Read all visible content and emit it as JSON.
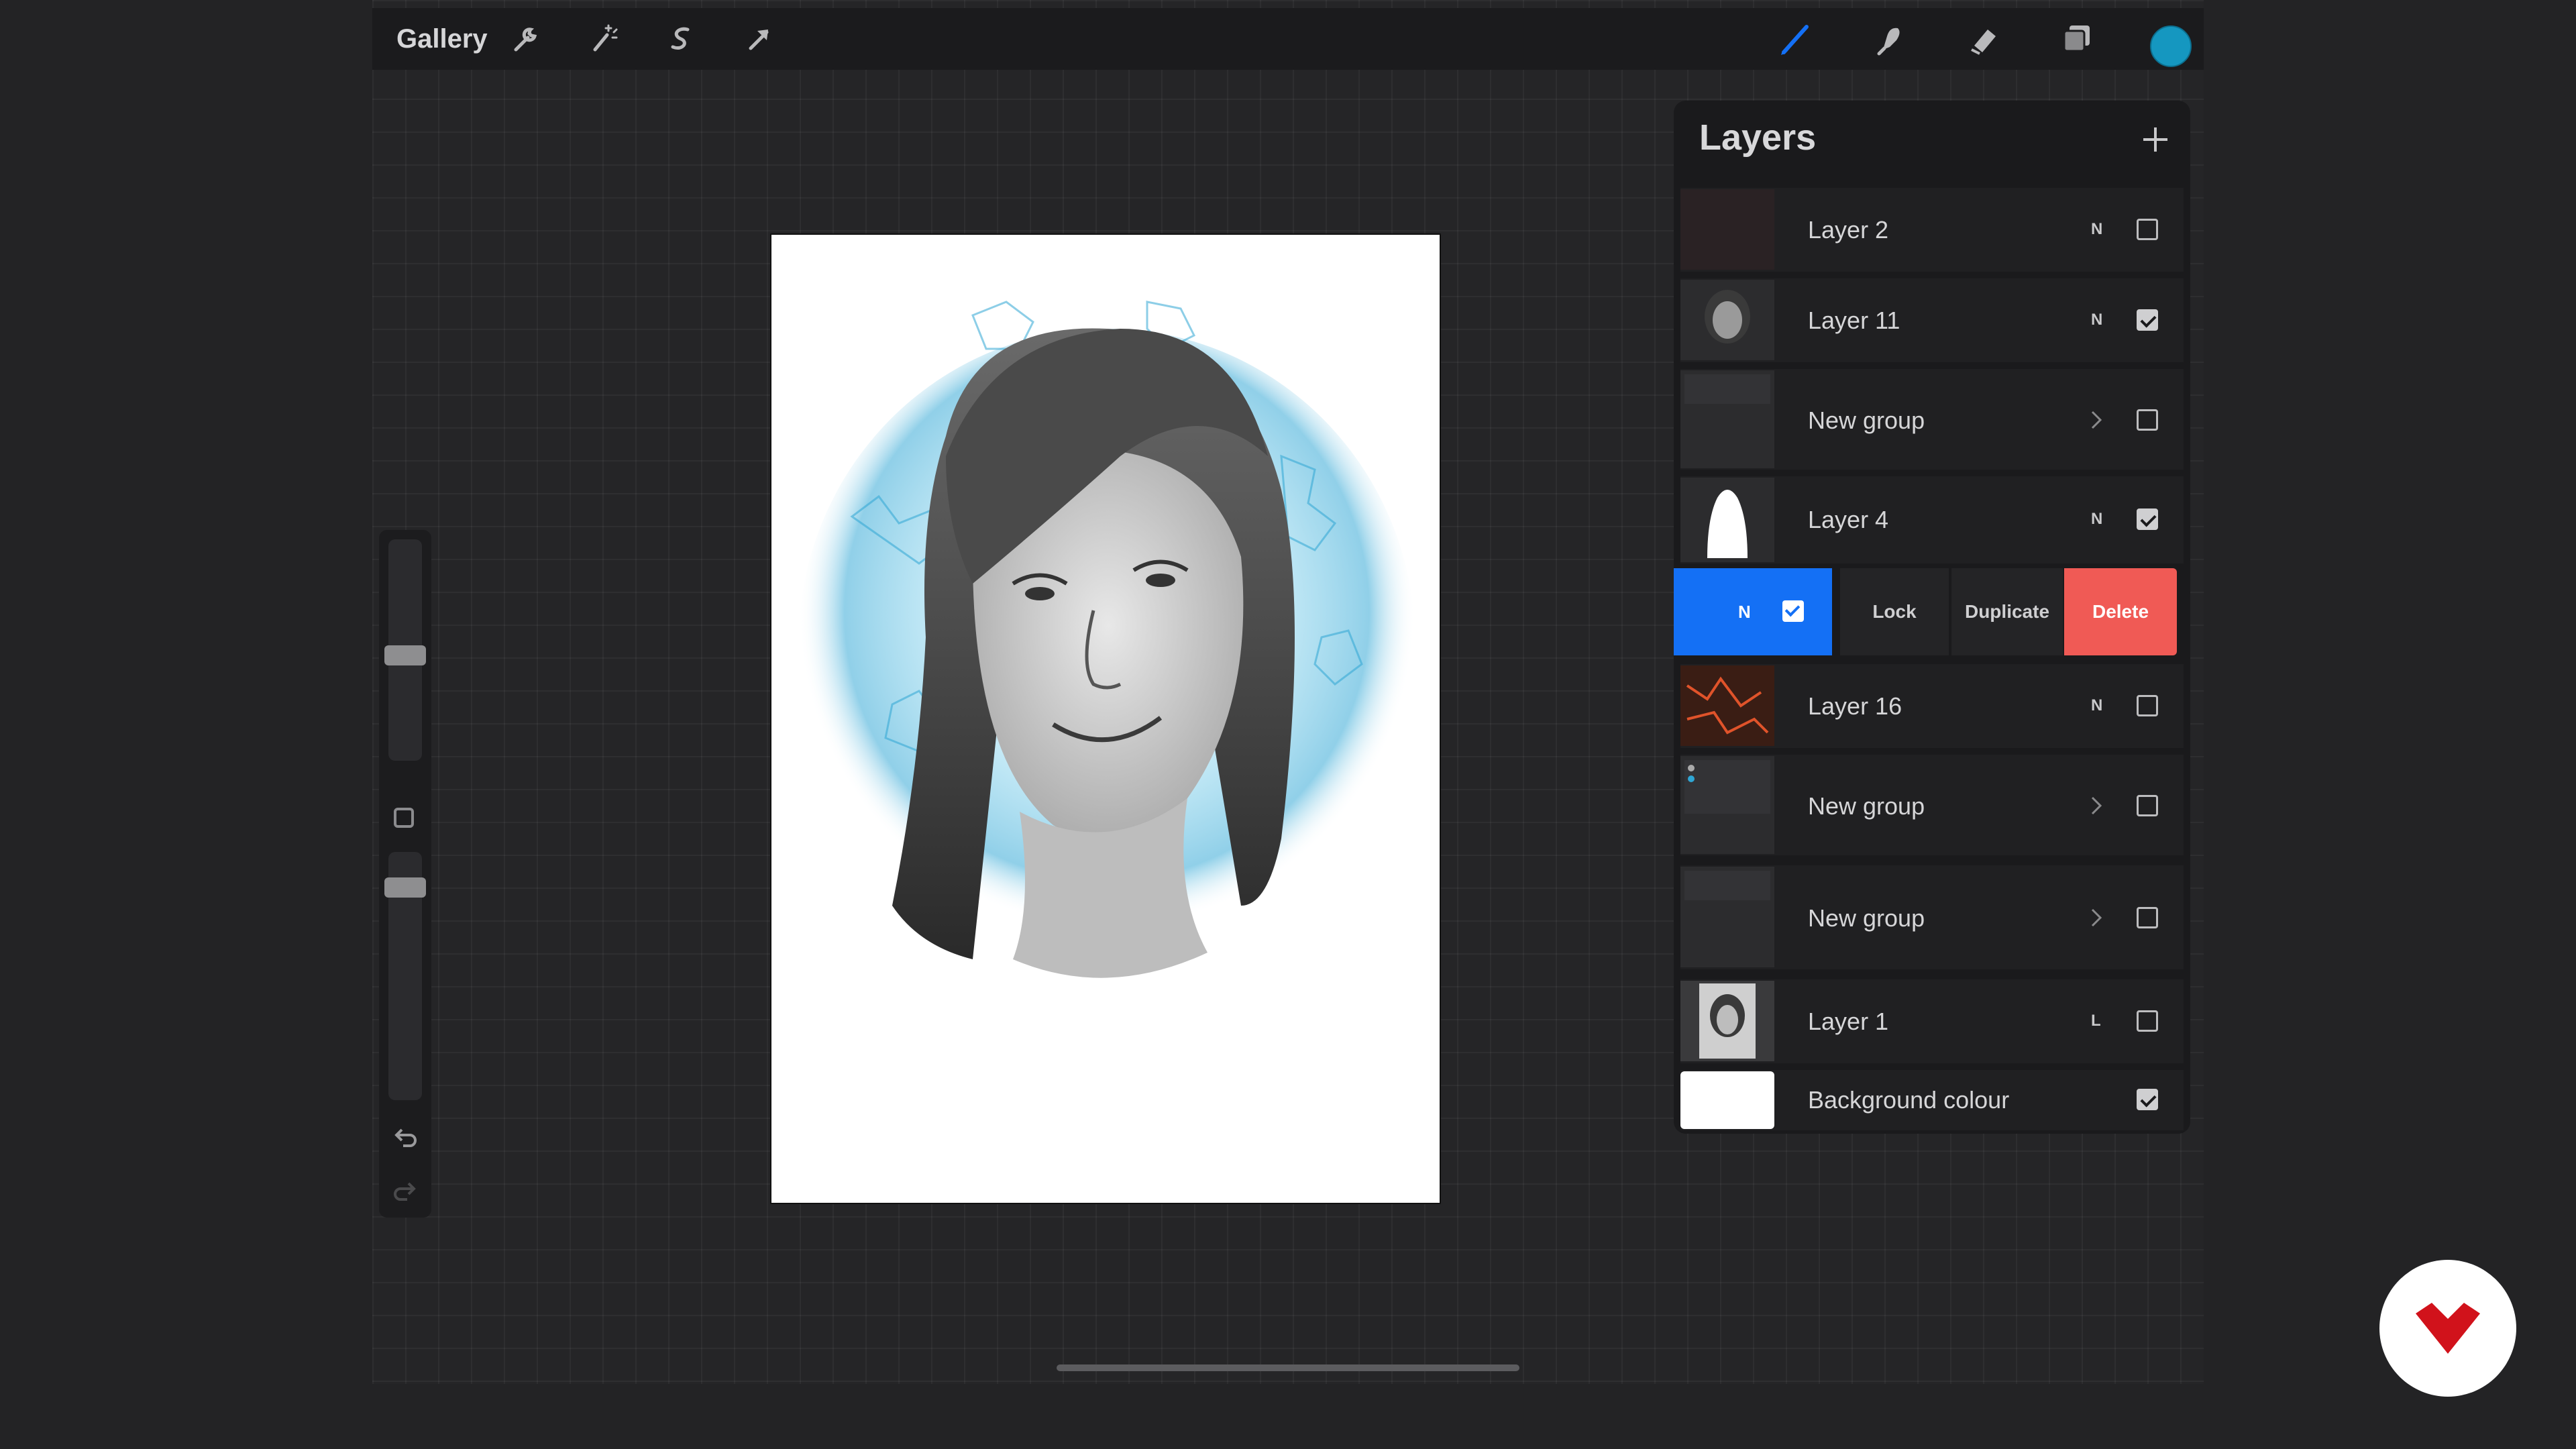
{
  "topbar": {
    "gallery_label": "Gallery",
    "left_tools": [
      "wrench-icon",
      "magic-wand-icon",
      "selection-icon",
      "transform-arrow-icon"
    ],
    "right_tools": [
      "brush-icon",
      "smudge-icon",
      "eraser-icon",
      "layers-icon"
    ],
    "active_color": "#1597c0",
    "active_tool_color": "#1470f5"
  },
  "layers_panel": {
    "title": "Layers",
    "add_icon": "plus-icon",
    "layers": [
      {
        "name": "Layer 2",
        "mode": "N",
        "visible": false
      },
      {
        "name": "Layer 11",
        "mode": "N",
        "visible": true
      },
      {
        "name": "New group",
        "type": "group",
        "visible": false
      },
      {
        "name": "Layer 4",
        "mode": "N",
        "visible": true
      },
      {
        "name": "Layer 16",
        "mode": "N",
        "visible": false
      },
      {
        "name": "New group",
        "type": "group",
        "visible": false
      },
      {
        "name": "New group",
        "type": "group",
        "visible": false
      },
      {
        "name": "Layer 1",
        "mode": "L",
        "visible": false
      },
      {
        "name": "Background colour",
        "visible": true
      }
    ],
    "swiped_layer": {
      "mode": "N",
      "visible": true,
      "actions": {
        "lock": "Lock",
        "duplicate": "Duplicate",
        "delete": "Delete"
      }
    }
  },
  "colors": {
    "accent_blue": "#1470f5",
    "delete_red": "#f05a55",
    "panel_bg": "#1a1a1c"
  }
}
